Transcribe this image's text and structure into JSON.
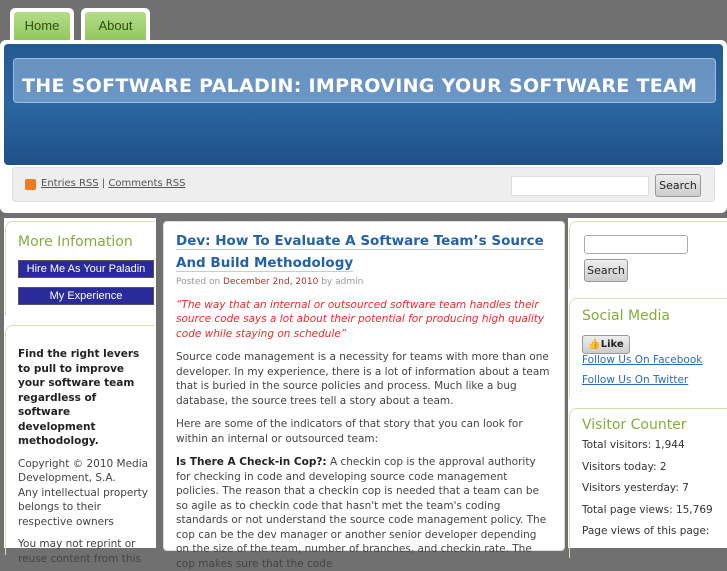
{
  "nav": {
    "tabs": [
      "Home",
      "About"
    ]
  },
  "header": {
    "title": "THE SOFTWARE PALADIN: IMPROVING YOUR SOFTWARE TEAM",
    "entries_rss": "Entries RSS",
    "sep": "|",
    "comments_rss": "Comments RSS",
    "search_label": "Search",
    "search_value": ""
  },
  "left": {
    "widget_title": "More Infomation",
    "buttons": [
      "Hire Me As Your Paladin",
      "My Experience"
    ],
    "tagline": "Find the right levers to pull to improve your software team regardless of software development methodology.",
    "copyright": "Copyright © 2010 Media Development, S.A.",
    "ip": "Any intellectual property belongs to their respective owners",
    "reprint": "You may not reprint or reuse content from this"
  },
  "post": {
    "title": "Dev: How To Evaluate A Software Team’s Source And Build Methodology",
    "posted_on": "Posted on",
    "date": "December 2nd, 2010",
    "by": "by admin",
    "quote": "“The way that an internal or outsourced software team handles their source code says a lot about their potential for producing high quality code while staying on schedule”",
    "p1": "Source code management is a necessity for teams with more than one developer. In my experience, there is a lot of information about a team that is buried in the source policies and process. Much like a bug database, the source trees tell a story about a team.",
    "p2": "Here are some of the indicators of that story that you can look for within an internal or outsourced team:",
    "p3_bold": "Is There A Check-in Cop?:",
    "p3": " A checkin cop is the approval authority for checking in code and developing source code management policies. The reason that a checkin cop is needed that a team can be so agile as to checkin code that hasn't met the team's coding standards or not understand the source code management policy.   The cop can be the dev manager or another senior developer depending on the size of the team, number of branches, and checkin rate. The cop makes sure that the code"
  },
  "right": {
    "search_label": "Search",
    "search_value": "",
    "social_title": "Social Media",
    "like": "Like",
    "facebook": "Follow Us On Facebook",
    "twitter": "Follow Us On Twitter",
    "counter_title": "Visitor Counter",
    "stats": [
      "Total visitors: 1,944",
      "Visitors today: 2",
      "Visitors yesterday: 7",
      "Total page views: 15,769",
      "Page views of this page:"
    ]
  }
}
